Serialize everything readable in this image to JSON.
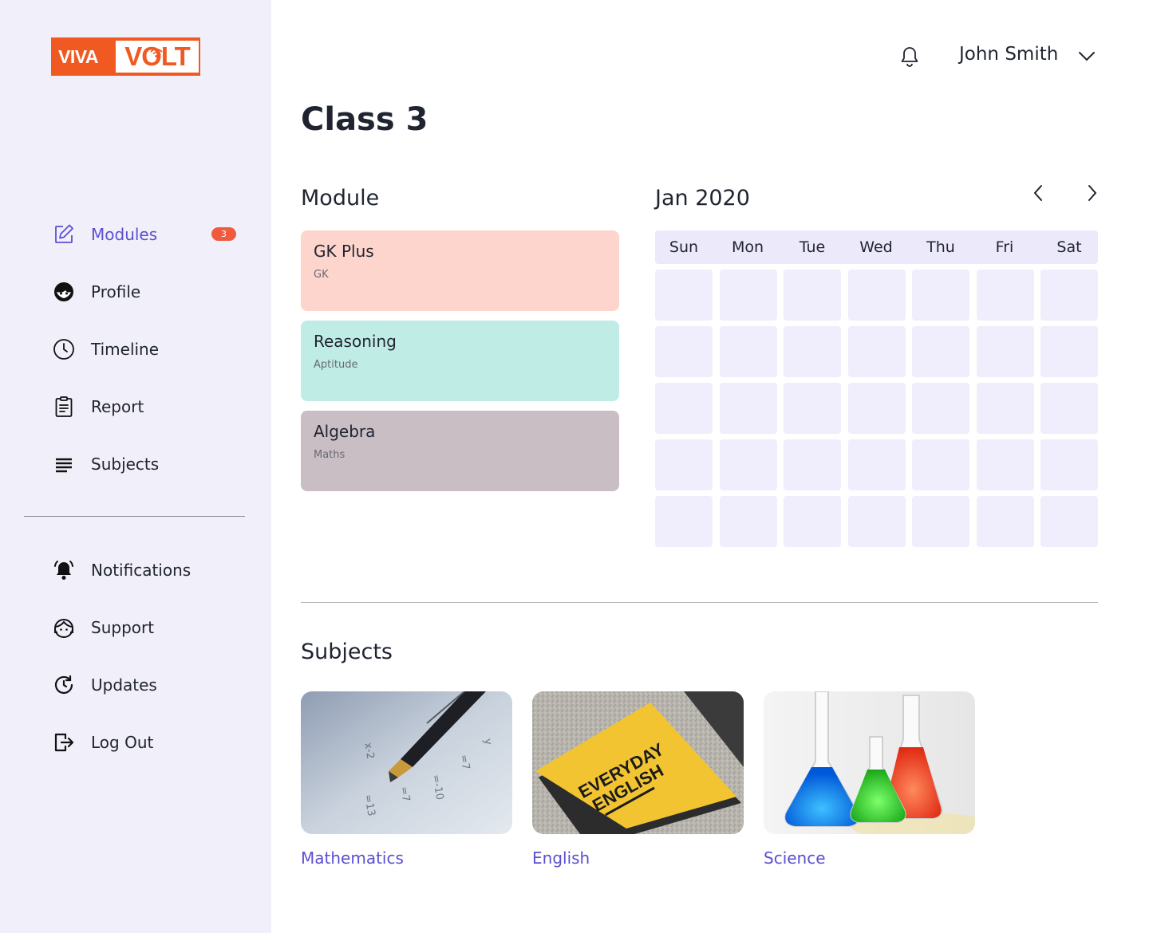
{
  "brand": {
    "part1": "VIVA",
    "part2": "VOLT",
    "orange": "#f05a22"
  },
  "sidebar": {
    "primary": [
      {
        "label": "Modules",
        "icon": "edit-icon",
        "badge": "3",
        "active": true
      },
      {
        "label": "Profile",
        "icon": "face-icon"
      },
      {
        "label": "Timeline",
        "icon": "clock-icon"
      },
      {
        "label": "Report",
        "icon": "clipboard-icon"
      },
      {
        "label": "Subjects",
        "icon": "list-icon"
      }
    ],
    "secondary": [
      {
        "label": "Notifications",
        "icon": "bell-ringing-icon"
      },
      {
        "label": "Support",
        "icon": "support-icon"
      },
      {
        "label": "Updates",
        "icon": "refresh-clock-icon"
      },
      {
        "label": "Log Out",
        "icon": "logout-icon"
      }
    ]
  },
  "header": {
    "user_name": "John Smith",
    "bell_icon": "bell-icon",
    "caret_icon": "chevron-down-icon"
  },
  "page": {
    "title": "Class 3"
  },
  "modules": {
    "title": "Module",
    "items": [
      {
        "title": "GK Plus",
        "subtitle": "GK",
        "color": "#fdd5cc"
      },
      {
        "title": "Reasoning",
        "subtitle": "Aptitude",
        "color": "#bfece5"
      },
      {
        "title": "Algebra",
        "subtitle": "Maths",
        "color": "#c8bec4"
      }
    ]
  },
  "calendar": {
    "month": "Jan 2020",
    "days": [
      "Sun",
      "Mon",
      "Tue",
      "Wed",
      "Thu",
      "Fri",
      "Sat"
    ],
    "week_rows": 5,
    "header_color": "#ece9fb",
    "cell_color": "#f0edfc"
  },
  "subjects": {
    "title": "Subjects",
    "items": [
      {
        "label": "Mathematics",
        "image": "pen-on-math-paper"
      },
      {
        "label": "English",
        "image": "everyday-english-book"
      },
      {
        "label": "Science",
        "image": "chemistry-flasks"
      }
    ]
  },
  "accent": "#5b4fd1"
}
